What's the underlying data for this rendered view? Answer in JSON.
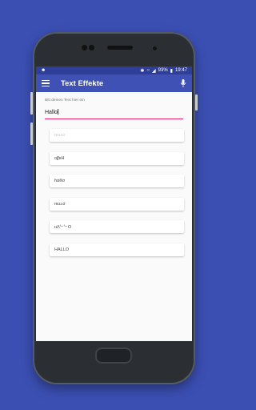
{
  "status": {
    "left_icon": "android-icon",
    "battery": "93%",
    "time": "19:47"
  },
  "appbar": {
    "title": "Text Effekte"
  },
  "main": {
    "input_label": "Bitt deinen Text hier ein",
    "input_value": "Hallo"
  },
  "effects": [
    {
      "text": "ʜᴀʟʟᴏ",
      "faded": true
    },
    {
      "text": "oʃʃɐH",
      "faded": false
    },
    {
      "text": "ɦαℓℓσ",
      "faded": false
    },
    {
      "text": "ʜєʟʟσ",
      "faded": false
    },
    {
      "text": "ʜΛᄂᄂO",
      "faded": false
    },
    {
      "text": "HALLO",
      "faded": false
    }
  ]
}
